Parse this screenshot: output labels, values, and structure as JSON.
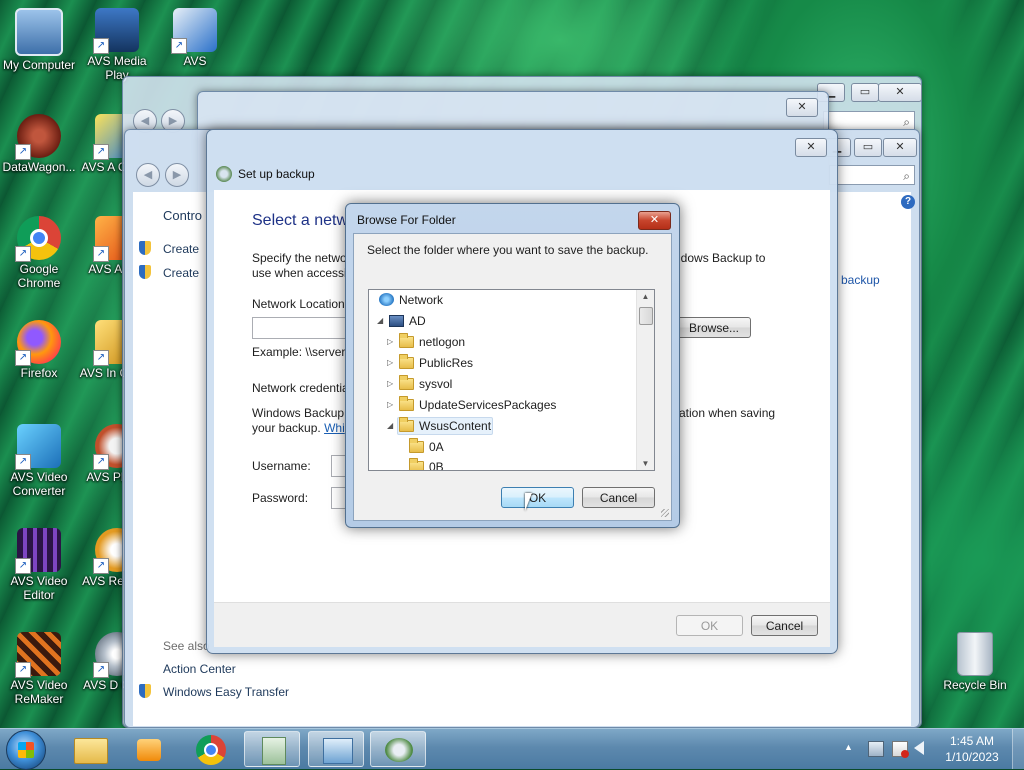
{
  "desktop_icons": [
    {
      "label": "My Computer",
      "icon": "computer-icon",
      "color": "#4f86c6"
    },
    {
      "label": "AVS Media Play",
      "icon": "media-player-icon",
      "color": "#2a5a9e"
    },
    {
      "label": "AVS",
      "icon": "avs-icon",
      "color": "#2a70c9"
    },
    {
      "label": "DataWagon...",
      "icon": "datawagon-icon",
      "color": "#7a2b1f"
    },
    {
      "label": "AVS A Conve",
      "icon": "avs-audio-converter-icon",
      "color": "#e3b11f"
    },
    {
      "label": "Google Chrome",
      "icon": "chrome-icon",
      "color": "#dd4b3e"
    },
    {
      "label": "AVS A Edit",
      "icon": "avs-audio-editor-icon",
      "color": "#e8631c"
    },
    {
      "label": "Firefox",
      "icon": "firefox-icon",
      "color": "#ff7a1a"
    },
    {
      "label": "AVS In Conve",
      "icon": "avs-image-converter-icon",
      "color": "#e1b52a"
    },
    {
      "label": "AVS Video Converter",
      "icon": "avs-video-converter-icon",
      "color": "#2f8fd4"
    },
    {
      "label": "AVS Pl Edit",
      "icon": "avs-photo-editor-icon",
      "color": "#c9552f"
    },
    {
      "label": "AVS Video Editor",
      "icon": "avs-video-editor-icon",
      "color": "#5b2a86"
    },
    {
      "label": "AVS Re Clea",
      "icon": "avs-registry-cleaner-icon",
      "color": "#d98c1a"
    },
    {
      "label": "AVS Video ReMaker",
      "icon": "avs-video-remaker-icon",
      "color": "#c2461a"
    },
    {
      "label": "AVS D Creat",
      "icon": "avs-disc-creator-icon",
      "color": "#9aa6b2"
    },
    {
      "label": "Recycle Bin",
      "icon": "recycle-bin-icon",
      "color": "#cfd8e2"
    }
  ],
  "control_panel": {
    "nav_partial": "Contro",
    "create_1": "Create",
    "create_2": "Create",
    "see_also": "See also",
    "action_center": "Action Center",
    "windows_easy_transfer": "Windows Easy Transfer",
    "backup_link": "backup"
  },
  "setup_backup": {
    "title": "Set up backup",
    "heading": "Select a netw",
    "desc_line1_left": "Specify the netwo",
    "desc_line1_right": "ndows Backup to",
    "desc_line2": "use when accessin",
    "network_location_label": "Network Location",
    "browse_button": "Browse...",
    "example": "Example: \\\\server\\",
    "network_credentials": "Network credentia",
    "wb_line1_left": "Windows Backup",
    "wb_line1_right": "ation when saving",
    "wb_line2": "your backup.",
    "wb_link": "Whi",
    "username_label": "Username:",
    "password_label": "Password:",
    "ok_button": "OK",
    "cancel_button": "Cancel"
  },
  "browse_dialog": {
    "title": "Browse For Folder",
    "instruction": "Select the folder where you want to save the backup.",
    "tree": [
      {
        "label": "Network",
        "level": 0,
        "expanded": true,
        "icon": "network-icon"
      },
      {
        "label": "AD",
        "level": 1,
        "expanded": true,
        "icon": "server-icon"
      },
      {
        "label": "netlogon",
        "level": 2,
        "expanded": false,
        "icon": "folder-icon"
      },
      {
        "label": "PublicRes",
        "level": 2,
        "expanded": false,
        "icon": "folder-icon"
      },
      {
        "label": "sysvol",
        "level": 2,
        "expanded": false,
        "icon": "folder-icon"
      },
      {
        "label": "UpdateServicesPackages",
        "level": 2,
        "expanded": false,
        "icon": "folder-icon"
      },
      {
        "label": "WsusContent",
        "level": 2,
        "expanded": true,
        "icon": "folder-icon",
        "selected": true
      },
      {
        "label": "0A",
        "level": 3,
        "expanded": false,
        "icon": "folder-icon"
      },
      {
        "label": "0B",
        "level": 3,
        "expanded": false,
        "icon": "folder-icon"
      }
    ],
    "ok_button": "OK",
    "cancel_button": "Cancel"
  },
  "taskbar": {
    "time": "1:45 AM",
    "date": "1/10/2023",
    "tray_expand": "▲"
  }
}
